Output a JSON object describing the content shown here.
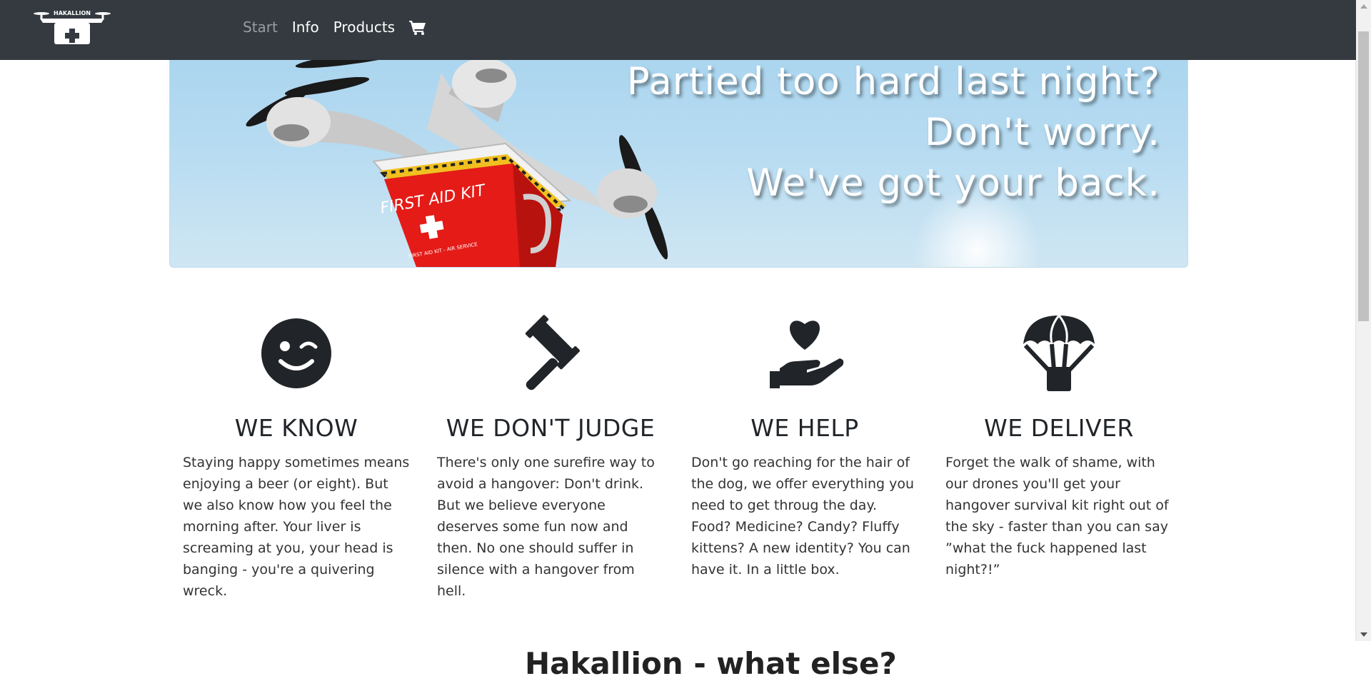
{
  "navbar": {
    "logo_text": "HAKALLION",
    "links": [
      {
        "label": "Start",
        "active": true
      },
      {
        "label": "Info",
        "active": false
      },
      {
        "label": "Products",
        "active": false
      }
    ],
    "cart_icon": "shopping-cart-icon"
  },
  "hero": {
    "kit_label": "FIRST AID KIT",
    "kit_sublabel": "FIRST AID KIT - AIR SERVICE",
    "lines": [
      "Partied too hard last night?",
      "Don't worry.",
      "We've got your back."
    ]
  },
  "features": [
    {
      "icon": "wink-face-icon",
      "title": "WE KNOW",
      "text": "Staying happy sometimes means enjoying a beer (or eight). But we also know how you feel the morning after. Your liver is screaming at you, your head is banging - you're a quivering wreck."
    },
    {
      "icon": "gavel-icon",
      "title": "WE DON'T JUDGE",
      "text": "There's only one surefire way to avoid a hangover: Don't drink. But we believe everyone deserves some fun now and then. No one should suffer in silence with a hangover from hell."
    },
    {
      "icon": "heart-hand-icon",
      "title": "WE HELP",
      "text": "Don't go reaching for the hair of the dog, we offer everything you need to get throug the day. Food? Medicine? Candy? Fluffy kittens? A new identity? You can have it. In a little box."
    },
    {
      "icon": "parachute-box-icon",
      "title": "WE DELIVER",
      "text": "Forget the walk of shame, with our drones you'll get your hangover survival kit right out of the sky - faster than you can say ”what the fuck happened last night?!”"
    }
  ],
  "next_section": {
    "heading": "Hakallion - what else?"
  },
  "colors": {
    "navbar": "#343a40",
    "text": "#212529",
    "active_link": "#9a9da1"
  }
}
